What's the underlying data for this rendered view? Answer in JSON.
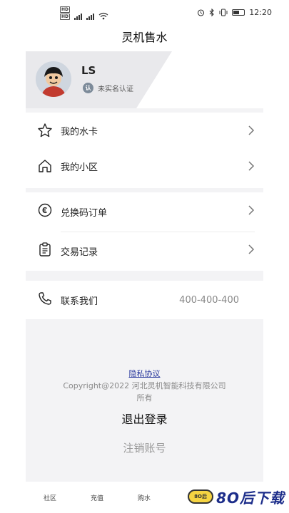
{
  "status_bar": {
    "hd1": "HD",
    "hd2": "HD",
    "time": "12:20"
  },
  "header": {
    "title": "灵机售水"
  },
  "profile": {
    "username": "LS",
    "verify_badge": "认",
    "verify_status": "未实名认证"
  },
  "menu": {
    "water_card": "我的水卡",
    "community": "我的小区",
    "redeem_orders": "兑换码订单",
    "transactions": "交易记录",
    "contact_label": "联系我们",
    "contact_phone": "400-400-400"
  },
  "footer": {
    "privacy": "隐私协议",
    "copyright": "Copyright@2022 河北灵机智能科技有限公司所有",
    "logout": "退出登录",
    "cancel_account": "注销账号"
  },
  "bottom_nav": {
    "community": "社区",
    "recharge": "充值",
    "buy_water": "购水"
  },
  "watermark": {
    "badge": "8O后",
    "text": "8O后下载"
  },
  "colors": {
    "panel_bg": "#f3f3f5",
    "link": "#2b3a9e",
    "muted": "#9a9a9a"
  }
}
